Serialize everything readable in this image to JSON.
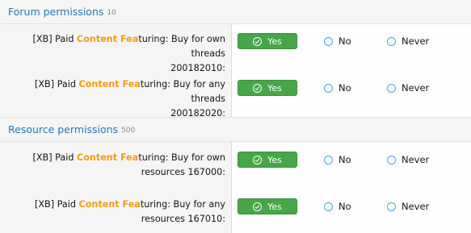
{
  "sections": [
    {
      "title": "Forum permissions",
      "count": "10",
      "rows": [
        {
          "prefix": "[XB] Paid ",
          "highlight_1": "Content Fea",
          "after_1": "turing: Buy for own threads",
          "line2": "200182010:"
        },
        {
          "prefix": "[XB] Paid ",
          "highlight_1": "Content Fea",
          "after_1": "turing: Buy for any threads",
          "line2": "200182020:"
        }
      ]
    },
    {
      "title": "Resource permissions",
      "count": "500",
      "rows": [
        {
          "prefix": "[XB] Paid ",
          "highlight_1": "Content Fea",
          "after_1": "turing: Buy for own",
          "line2": "resources 167000:"
        },
        {
          "prefix": "[XB] Paid ",
          "highlight_1": "Content Fea",
          "after_1": "turing: Buy for any",
          "line2": "resources 167010:"
        }
      ]
    }
  ],
  "options": {
    "yes": "Yes",
    "no": "No",
    "never": "Never"
  },
  "colors": {
    "accent": "#2577b1",
    "highlight": "#f39c12",
    "yes_button": "#47a647",
    "radio": "#47a3e0"
  }
}
